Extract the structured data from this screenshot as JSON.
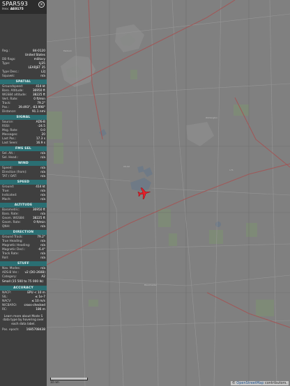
{
  "aircraft": {
    "callsign": "SPAR593",
    "hex_label": "Hex:",
    "hex_value": "AE0175"
  },
  "details": [
    {
      "k": "Reg.:",
      "v": "84-0120"
    },
    {
      "k": "",
      "v": "United States"
    },
    {
      "k": "DB flags:",
      "v": "military"
    },
    {
      "k": "Type:",
      "v": "LJ35"
    },
    {
      "k": "",
      "v": "LEARJET 35"
    },
    {
      "k": "Type Desc.:",
      "v": "L2J"
    },
    {
      "k": "Squawk:",
      "v": "n/a"
    }
  ],
  "spatial": {
    "title": "SPATIAL",
    "rows": [
      {
        "k": "Groundspeed:",
        "v": "414 kt"
      },
      {
        "k": "Baro. Altitude:",
        "v": "36950 ft"
      },
      {
        "k": "WGS84 altitude:",
        "v": "38225 ft"
      },
      {
        "k": "Vert. Rate:",
        "v": "0 ft/min"
      },
      {
        "k": "Track:",
        "v": "79.2°"
      },
      {
        "k": "Pos.:",
        "v": "39.493°, -83.998°"
      },
      {
        "k": "Distance:",
        "v": "91.1 nmi"
      }
    ]
  },
  "signal": {
    "title": "SIGNAL",
    "rows": [
      {
        "k": "Source:",
        "v": "ADS-B"
      },
      {
        "k": "RSSI:",
        "v": "-24.5"
      },
      {
        "k": "Msg. Rate:",
        "v": "0.0"
      },
      {
        "k": "Messages:",
        "v": "20"
      },
      {
        "k": "Last Pos.:",
        "v": "17.3 s"
      },
      {
        "k": "Last Seen:",
        "v": "16.9 s"
      }
    ]
  },
  "fms": {
    "title": "FMS SEL",
    "rows": [
      {
        "k": "Sel. Alt.:",
        "v": "n/a"
      },
      {
        "k": "Sel. Head.:",
        "v": "n/a"
      }
    ]
  },
  "wind": {
    "title": "WIND",
    "rows": [
      {
        "k": "Speed:",
        "v": "n/a"
      },
      {
        "k": "Direction (from):",
        "v": "n/a"
      },
      {
        "k": "TAT / OAT:",
        "v": "n/a"
      }
    ]
  },
  "speed": {
    "title": "SPEED",
    "rows": [
      {
        "k": "Ground:",
        "v": "414 kt"
      },
      {
        "k": "True:",
        "v": "n/a"
      },
      {
        "k": "Indicated:",
        "v": "n/a"
      },
      {
        "k": "Mach:",
        "v": "n/a"
      }
    ]
  },
  "altitude": {
    "title": "ALTITUDE",
    "rows": [
      {
        "k": "Barometric:",
        "v": "36950 ft"
      },
      {
        "k": "Baro. Rate:",
        "v": "n/a"
      },
      {
        "k": "Geom. WGS84:",
        "v": "38225 ft"
      },
      {
        "k": "Geom. Rate:",
        "v": "0 ft/min"
      },
      {
        "k": "QNH:",
        "v": "n/a"
      }
    ]
  },
  "direction": {
    "title": "DIRECTION",
    "rows": [
      {
        "k": "Ground Track:",
        "v": "79.2°"
      },
      {
        "k": "True Heading:",
        "v": "n/a"
      },
      {
        "k": "Magnetic Heading:",
        "v": "n/a"
      },
      {
        "k": "Magnetic Decl.:",
        "v": "-6.4°"
      },
      {
        "k": "Track Rate:",
        "v": "n/a"
      },
      {
        "k": "Roll:",
        "v": "n/a"
      }
    ]
  },
  "stuff": {
    "title": "STUFF",
    "rows": [
      {
        "k": "Nav. Modes:",
        "v": "n/a"
      },
      {
        "k": "ADS-B Ver.:",
        "v": "v2 (DO-260B)"
      },
      {
        "k": "Category:",
        "v": "A2"
      }
    ],
    "category_desc": "Small (15 500 to 75 000 lb)"
  },
  "accuracy": {
    "title": "ACCURACY",
    "rows": [
      {
        "k": "NACP:",
        "v": "EPU < 10 m"
      },
      {
        "k": "SIL:",
        "v": "≤ 1e-7"
      },
      {
        "k": "NACV:",
        "v": "≤ 10 m/s"
      },
      {
        "k": "NICBARO:",
        "v": "cross-checked"
      },
      {
        "k": "RC:",
        "v": "186 m"
      }
    ]
  },
  "info_text": "Learn more about Mode S data type by hovering over each data label.",
  "pos_epoch": {
    "k": "Pos. epoch:",
    "v": "1685708438"
  },
  "map": {
    "attribution_prefix": "© ",
    "attribution_link": "OpenStreetMap",
    "attribution_suffix": " contributors.",
    "scale_label": "10 nm"
  }
}
